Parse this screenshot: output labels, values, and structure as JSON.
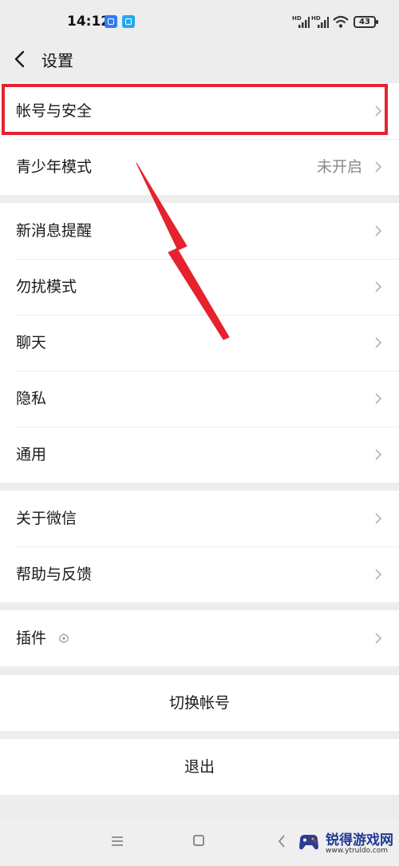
{
  "status_bar": {
    "time": "14:12",
    "signal_label_1": "HD",
    "signal_label_2": "HD",
    "battery": "43"
  },
  "header": {
    "title": "设置"
  },
  "groups": [
    {
      "items": [
        {
          "label": "帐号与安全",
          "value": ""
        },
        {
          "label": "青少年模式",
          "value": "未开启"
        }
      ]
    },
    {
      "items": [
        {
          "label": "新消息提醒"
        },
        {
          "label": "勿扰模式"
        },
        {
          "label": "聊天"
        },
        {
          "label": "隐私"
        },
        {
          "label": "通用"
        }
      ]
    },
    {
      "items": [
        {
          "label": "关于微信"
        },
        {
          "label": "帮助与反馈"
        }
      ]
    },
    {
      "items": [
        {
          "label": "插件"
        }
      ]
    }
  ],
  "actions": {
    "switch_account": "切换帐号",
    "logout": "退出"
  },
  "annotation": {
    "color": "#e5232e"
  },
  "watermark": {
    "name": "锐得游戏网",
    "url": "www.ytruldo.com"
  }
}
